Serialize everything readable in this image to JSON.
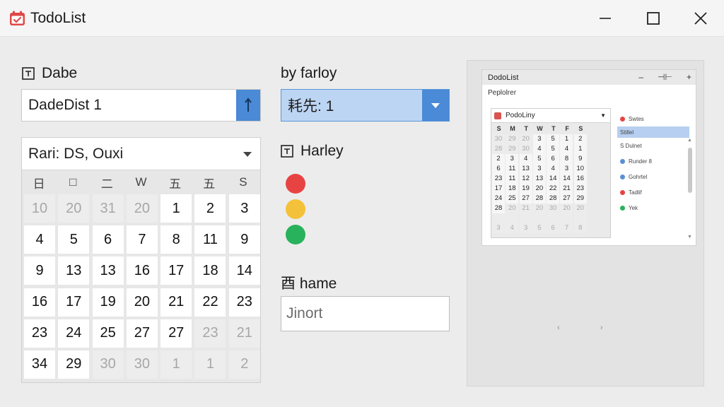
{
  "window": {
    "title": "TodoList"
  },
  "left": {
    "date_label": "Dabe",
    "date_value": "DadeDist  1",
    "range_select": "Rari: DS, Ouxi",
    "weekdays": [
      "日",
      "□",
      "二",
      "W",
      "五",
      "五",
      "S"
    ],
    "days": [
      {
        "t": "10",
        "m": false
      },
      {
        "t": "20",
        "m": false
      },
      {
        "t": "31",
        "m": false
      },
      {
        "t": "20",
        "m": false
      },
      {
        "t": "1",
        "m": true
      },
      {
        "t": "2",
        "m": true
      },
      {
        "t": "3",
        "m": true
      },
      {
        "t": "4",
        "m": true
      },
      {
        "t": "5",
        "m": true
      },
      {
        "t": "6",
        "m": true
      },
      {
        "t": "7",
        "m": true
      },
      {
        "t": "8",
        "m": true
      },
      {
        "t": "11",
        "m": true
      },
      {
        "t": "9",
        "m": true
      },
      {
        "t": "9",
        "m": true
      },
      {
        "t": "13",
        "m": true
      },
      {
        "t": "13",
        "m": true
      },
      {
        "t": "16",
        "m": true
      },
      {
        "t": "17",
        "m": true
      },
      {
        "t": "18",
        "m": true
      },
      {
        "t": "14",
        "m": true
      },
      {
        "t": "16",
        "m": true
      },
      {
        "t": "17",
        "m": true
      },
      {
        "t": "19",
        "m": true
      },
      {
        "t": "20",
        "m": true
      },
      {
        "t": "21",
        "m": true
      },
      {
        "t": "22",
        "m": true
      },
      {
        "t": "23",
        "m": true
      },
      {
        "t": "23",
        "m": true
      },
      {
        "t": "24",
        "m": true
      },
      {
        "t": "25",
        "m": true
      },
      {
        "t": "27",
        "m": true
      },
      {
        "t": "27",
        "m": true
      },
      {
        "t": "23",
        "m": false
      },
      {
        "t": "21",
        "m": false
      },
      {
        "t": "34",
        "m": true
      },
      {
        "t": "29",
        "m": true
      },
      {
        "t": "30",
        "m": false
      },
      {
        "t": "30",
        "m": false
      },
      {
        "t": "1",
        "m": false
      },
      {
        "t": "1",
        "m": false
      },
      {
        "t": "2",
        "m": false
      }
    ]
  },
  "middle": {
    "by_label": "by farloy",
    "by_value": "耗先: 1",
    "harley_label": "Harley",
    "status_colors": [
      "#e84343",
      "#f4c13a",
      "#28b25c"
    ],
    "name_label": "⾣ hame",
    "name_value": "Jinort"
  },
  "preview": {
    "title": "DodoList",
    "ctrls": [
      "–",
      "⊣⊢",
      "+"
    ],
    "subtitle": "Peplolrer",
    "cal_title": "PodoLiny",
    "weekdays": [
      "S",
      "M",
      "T",
      "⊏",
      "W",
      "T",
      "F",
      "S"
    ],
    "days": [
      {
        "t": "30",
        "m": false
      },
      {
        "t": "29",
        "m": false
      },
      {
        "t": "20",
        "m": false
      },
      {
        "t": "3",
        "m": true
      },
      {
        "t": "5",
        "m": true
      },
      {
        "t": "1",
        "m": true
      },
      {
        "t": "2",
        "m": true
      },
      {
        "t": "28",
        "m": false
      },
      {
        "t": "29",
        "m": false
      },
      {
        "t": "30",
        "m": false
      },
      {
        "t": "4",
        "m": true
      },
      {
        "t": "5",
        "m": true
      },
      {
        "t": "4",
        "m": true
      },
      {
        "t": "1",
        "m": true
      },
      {
        "t": "2",
        "m": true
      },
      {
        "t": "3",
        "m": true
      },
      {
        "t": "4",
        "m": true
      },
      {
        "t": "5",
        "m": true
      },
      {
        "t": "6",
        "m": true
      },
      {
        "t": "8",
        "m": true
      },
      {
        "t": "9",
        "m": true
      },
      {
        "t": "6",
        "m": true
      },
      {
        "t": "11",
        "m": true
      },
      {
        "t": "13",
        "m": true
      },
      {
        "t": "3",
        "m": true
      },
      {
        "t": "4",
        "m": true
      },
      {
        "t": "3",
        "m": true
      },
      {
        "t": "10",
        "m": true
      },
      {
        "t": "23",
        "m": true
      },
      {
        "t": "11",
        "m": true
      },
      {
        "t": "12",
        "m": true
      },
      {
        "t": "13",
        "m": true
      },
      {
        "t": "14",
        "m": true
      },
      {
        "t": "14",
        "m": true
      },
      {
        "t": "16",
        "m": true
      },
      {
        "t": "17",
        "m": true
      },
      {
        "t": "18",
        "m": true
      },
      {
        "t": "19",
        "m": true
      },
      {
        "t": "20",
        "m": true
      },
      {
        "t": "22",
        "m": true
      },
      {
        "t": "21",
        "m": true
      },
      {
        "t": "23",
        "m": true
      },
      {
        "t": "24",
        "m": true
      },
      {
        "t": "25",
        "m": true
      },
      {
        "t": "27",
        "m": true
      },
      {
        "t": "28",
        "m": true
      },
      {
        "t": "28",
        "m": true
      },
      {
        "t": "27",
        "m": true
      },
      {
        "t": "29",
        "m": true
      },
      {
        "t": "28",
        "m": true
      },
      {
        "t": "20",
        "m": false
      },
      {
        "t": "21",
        "m": false
      },
      {
        "t": "20",
        "m": false
      },
      {
        "t": "30",
        "m": false
      },
      {
        "t": "20",
        "m": false
      },
      {
        "t": "20",
        "m": false
      },
      {
        "t": "",
        "m": false
      },
      {
        "t": "",
        "m": false
      },
      {
        "t": "",
        "m": false
      },
      {
        "t": "",
        "m": false
      },
      {
        "t": "",
        "m": false
      },
      {
        "t": "",
        "m": false
      },
      {
        "t": "",
        "m": false
      },
      {
        "t": "3",
        "m": false
      },
      {
        "t": "4",
        "m": false
      },
      {
        "t": "3",
        "m": false
      },
      {
        "t": "5",
        "m": false
      },
      {
        "t": "6",
        "m": false
      },
      {
        "t": "7",
        "m": false
      },
      {
        "t": "8",
        "m": false
      }
    ],
    "side": [
      {
        "label": "Swtes",
        "color": "#e84343"
      },
      {
        "label": "Stillel",
        "color": "",
        "selected": true
      },
      {
        "label": "S Dulnet",
        "color": ""
      },
      {
        "label": "Runder 8",
        "color": "#5a8fd6"
      },
      {
        "label": "Gohrtel",
        "color": "#5a8fd6"
      },
      {
        "label": "Tadlif",
        "color": "#e84343"
      },
      {
        "label": "Yek",
        "color": "#28b25c"
      }
    ],
    "pager": [
      "‹",
      "›"
    ]
  }
}
